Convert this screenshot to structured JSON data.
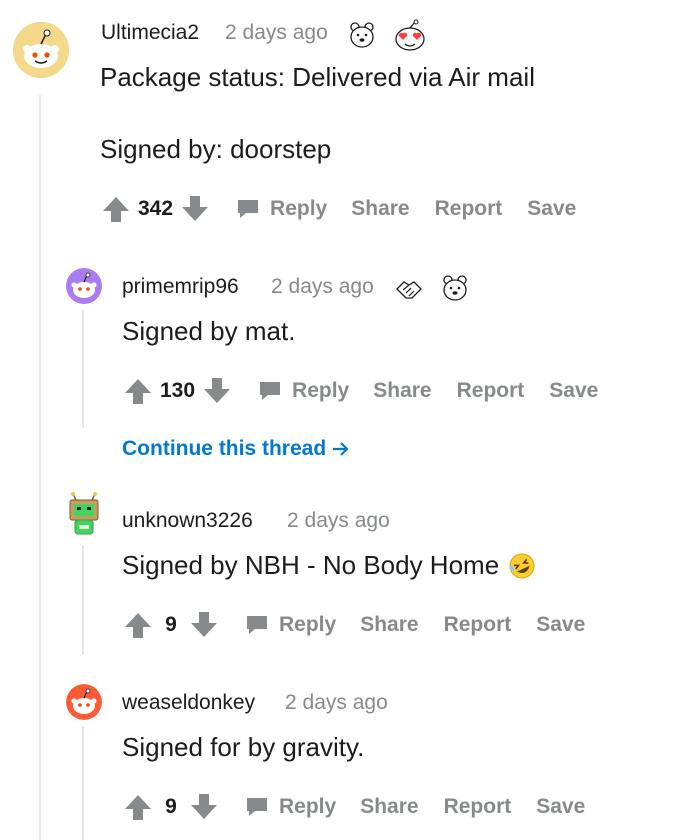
{
  "comments": [
    {
      "username": "Ultimecia2",
      "timestamp": "2 days ago",
      "avatar": "snoo-avatar-default",
      "awards": [
        "polar-bear-award",
        "heart-eyes-snoo-award"
      ],
      "body_lines": [
        "Package status: Delivered via Air mail",
        "Signed by: doorstep"
      ],
      "score": "342"
    },
    {
      "username": "primemrip96",
      "timestamp": "2 days ago",
      "avatar": "snoo-avatar-purple",
      "awards": [
        "handshake-award",
        "polar-bear-award"
      ],
      "body_lines": [
        "Signed by mat."
      ],
      "score": "130"
    },
    {
      "username": "unknown3226",
      "timestamp": "2 days ago",
      "avatar": "robot-avatar",
      "awards": [],
      "body_lines": [
        "Signed by NBH - No Body Home"
      ],
      "body_emoji": "rofl-emoji",
      "score": "9"
    },
    {
      "username": "weaseldonkey",
      "timestamp": "2 days ago",
      "avatar": "snoo-avatar-red",
      "awards": [],
      "body_lines": [
        "Signed for by gravity."
      ],
      "score": "9"
    }
  ],
  "actions": {
    "reply": "Reply",
    "share": "Share",
    "report": "Report",
    "save": "Save"
  },
  "continue_thread": "Continue this thread",
  "colors": {
    "muted": "#878a8c",
    "text": "#1c1c1c",
    "link": "#0079d3",
    "thread_line": "#e6e6e6"
  }
}
